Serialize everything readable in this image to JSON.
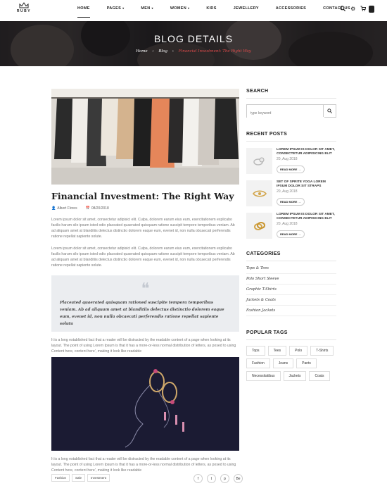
{
  "brand": {
    "logo_text": "RUBY"
  },
  "nav": {
    "items": [
      {
        "label": "HOME",
        "caret": false,
        "active": true
      },
      {
        "label": "PAGES",
        "caret": true,
        "active": false
      },
      {
        "label": "MEN",
        "caret": true,
        "active": false
      },
      {
        "label": "WOMEN",
        "caret": true,
        "active": false
      },
      {
        "label": "KIDS",
        "caret": false,
        "active": false
      },
      {
        "label": "JEWELLERY",
        "caret": false,
        "active": false
      },
      {
        "label": "ACCESSORIES",
        "caret": false,
        "active": false
      },
      {
        "label": "CONTACT US",
        "caret": false,
        "active": false
      }
    ],
    "icons": [
      "search-icon",
      "gear-icon",
      "cart-icon"
    ],
    "cart_count": "0"
  },
  "hero": {
    "title": "BLOG DETAILS",
    "breadcrumb": [
      "Home",
      "Blog",
      "Financial Investment: The Right Way"
    ]
  },
  "post": {
    "title": "Financial Investment: The Right Way",
    "author": "Albert Flores",
    "date": "08/20/2018",
    "paragraph1": "Lorem ipsum dolor sit amet, consectetur adipisici elit. Culpa, dolorem earum eius eum, exercitationem explicabo facilis harum silo ipsum isted odio placeated quaerated quisquam ratione suscipit tempore temporibus veniam. Ab ad aliquam amet at blanditiis delectus distinctio dolorem eaque eum, evenet id, non nulla obcaecati perferendis ratione repellat sapiente solute.",
    "paragraph2": "Lorem ipsum dolor sit amet, consectetur adipisici elit. Culpa, dolorem earum eius eum, exercitationem explicabo facilis harum silo ipsum isted odio placeated quaerated quisquam ratione suscipit tempore temporibus veniam. Ab ad aliquam amet at blanditiis delectus distinctio dolorem eaque eum, evenet id, non nulla obcaecati perferendis ratione repellat sapiente solute.",
    "quote": "Placeated quaerated quisquam rationed suscipite tempora temporibus veniam. Ab ad aliquam amet at blanditiis delectus distinctio dolorem eaque eum, evenet id, non nulla obcaecati perferendis ratione repellat sapiente soluta",
    "paragraph3": "It is a long established fact that a reader will be distracted by the readable content of a page when looking at its layout. The point of using Lorem Ipsum is that it has a more-or-less normal distribution of letters, as posed to using Content here, content here', making it look like readable",
    "paragraph4": "It is a long established fact that a reader will be distracted by the readable content of a page when looking at its layout. The point of using Lorem Ipsum is that it has a more-or-less normal distribution of letters, as posed to using Content here, content here', making it look like readable",
    "tags": [
      "Fashion",
      "Sale",
      "Investment"
    ],
    "share_icons": [
      "facebook-icon",
      "twitter-icon",
      "pinterest-icon",
      "behance-icon"
    ]
  },
  "sidebar": {
    "search_title": "SEARCH",
    "search_placeholder": "type keyword",
    "recent_title": "RECENT POSTS",
    "recent_posts": [
      {
        "title": "LOREM IPSUM IS DOLOR SIT AMET, CONSECTETUR ADIPISICING ELIT",
        "date": "20, Aug 2018",
        "button": "READ MORE →"
      },
      {
        "title": "SET OF SPRITE YOGA LOREM IPSUM DOLOR SIT STRAPS",
        "date": "20, Aug 2018",
        "button": "READ MORE →"
      },
      {
        "title": "LOREM IPSUM IS DOLOR SIT AMET, CONSECTETUR ADIPISICING ELIT",
        "date": "20, Aug 2018",
        "button": "READ MORE →"
      }
    ],
    "categories_title": "CATEGORIES",
    "categories": [
      "Tops & Tees",
      "Polo Short Sleeve",
      "Graphic T-Shirts",
      "Jackets & Coats",
      "Fashion Jackets"
    ],
    "tags_title": "POPULAR TAGS",
    "tags": [
      "Tops",
      "Tees",
      "Polo",
      "T-Shirts",
      "Fashion",
      "Jeans",
      "Pants",
      "Necessitatibus",
      "Jackets",
      "Coats"
    ]
  }
}
